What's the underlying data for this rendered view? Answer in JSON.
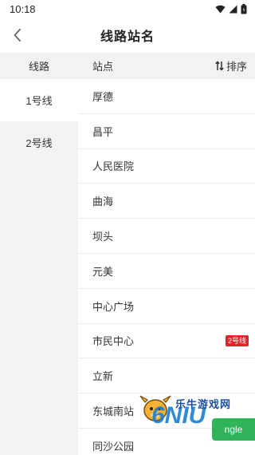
{
  "status_bar": {
    "time": "10:18"
  },
  "header": {
    "title": "线路站名"
  },
  "left": {
    "header": "线路",
    "lines": [
      {
        "label": "1号线",
        "active": true
      },
      {
        "label": "2号线",
        "active": false
      }
    ]
  },
  "right": {
    "header": "站点",
    "sort_label": "排序",
    "stations": [
      {
        "name": "厚德",
        "badge": ""
      },
      {
        "name": "昌平",
        "badge": ""
      },
      {
        "name": "人民医院",
        "badge": ""
      },
      {
        "name": "曲海",
        "badge": ""
      },
      {
        "name": "坝头",
        "badge": ""
      },
      {
        "name": "元美",
        "badge": ""
      },
      {
        "name": "中心广场",
        "badge": ""
      },
      {
        "name": "市民中心",
        "badge": "2号线"
      },
      {
        "name": "立新",
        "badge": ""
      },
      {
        "name": "东城南站",
        "badge": ""
      },
      {
        "name": "同沙公园",
        "badge": ""
      }
    ]
  },
  "watermark": {
    "text": "乐牛游戏网",
    "big": "6NIU",
    "toast": "ngle"
  },
  "colors": {
    "badge": "#e0242c",
    "panel_bg": "#f2f2f2",
    "toast_green": "#2fb45a"
  }
}
